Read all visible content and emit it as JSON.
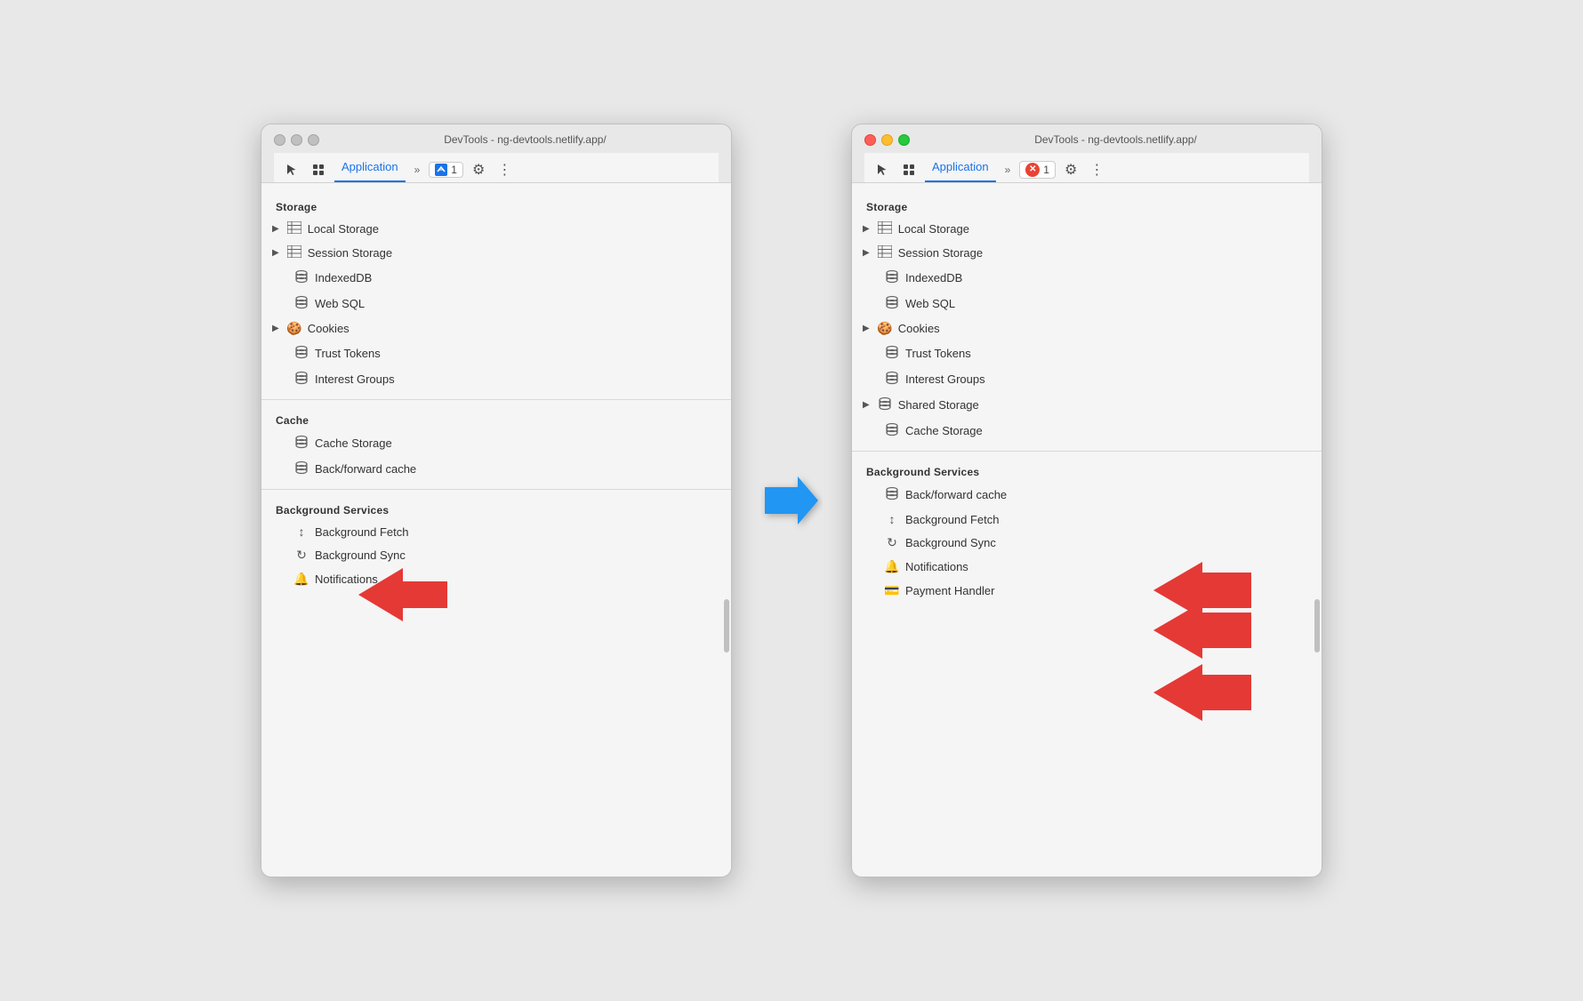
{
  "left_window": {
    "title": "DevTools - ng-devtools.netlify.app/",
    "tab_label": "Application",
    "badge_count": "1",
    "sections": {
      "storage": {
        "label": "Storage",
        "items": [
          {
            "id": "local-storage",
            "icon": "grid",
            "label": "Local Storage",
            "has_arrow": true,
            "indented": false
          },
          {
            "id": "session-storage",
            "icon": "grid",
            "label": "Session Storage",
            "has_arrow": true,
            "indented": false
          },
          {
            "id": "indexeddb",
            "icon": "db",
            "label": "IndexedDB",
            "has_arrow": false,
            "indented": true
          },
          {
            "id": "web-sql",
            "icon": "db",
            "label": "Web SQL",
            "has_arrow": false,
            "indented": true
          },
          {
            "id": "cookies",
            "icon": "cookie",
            "label": "Cookies",
            "has_arrow": true,
            "indented": false
          },
          {
            "id": "trust-tokens",
            "icon": "db",
            "label": "Trust Tokens",
            "has_arrow": false,
            "indented": true
          },
          {
            "id": "interest-groups",
            "icon": "db",
            "label": "Interest Groups",
            "has_arrow": false,
            "indented": true
          }
        ]
      },
      "cache": {
        "label": "Cache",
        "items": [
          {
            "id": "cache-storage",
            "icon": "db",
            "label": "Cache Storage",
            "has_arrow": false,
            "indented": true
          },
          {
            "id": "back-forward",
            "icon": "db",
            "label": "Back/forward cache",
            "has_arrow": false,
            "indented": true
          }
        ]
      },
      "background_services": {
        "label": "Background Services",
        "items": [
          {
            "id": "bg-fetch",
            "icon": "arrows",
            "label": "Background Fetch",
            "has_arrow": false,
            "indented": true
          },
          {
            "id": "bg-sync",
            "icon": "sync",
            "label": "Background Sync",
            "has_arrow": false,
            "indented": true
          },
          {
            "id": "notifications",
            "icon": "bell",
            "label": "Notifications",
            "has_arrow": false,
            "indented": true
          }
        ]
      }
    }
  },
  "right_window": {
    "title": "DevTools - ng-devtools.netlify.app/",
    "tab_label": "Application",
    "badge_count": "1",
    "sections": {
      "storage": {
        "label": "Storage",
        "items": [
          {
            "id": "local-storage",
            "icon": "grid",
            "label": "Local Storage",
            "has_arrow": true,
            "indented": false
          },
          {
            "id": "session-storage",
            "icon": "grid",
            "label": "Session Storage",
            "has_arrow": true,
            "indented": false
          },
          {
            "id": "indexeddb",
            "icon": "db",
            "label": "IndexedDB",
            "has_arrow": false,
            "indented": true
          },
          {
            "id": "web-sql",
            "icon": "db",
            "label": "Web SQL",
            "has_arrow": false,
            "indented": true
          },
          {
            "id": "cookies",
            "icon": "cookie",
            "label": "Cookies",
            "has_arrow": true,
            "indented": false
          },
          {
            "id": "trust-tokens",
            "icon": "db",
            "label": "Trust Tokens",
            "has_arrow": false,
            "indented": true
          },
          {
            "id": "interest-groups",
            "icon": "db",
            "label": "Interest Groups",
            "has_arrow": false,
            "indented": true
          },
          {
            "id": "shared-storage",
            "icon": "db",
            "label": "Shared Storage",
            "has_arrow": true,
            "indented": false
          },
          {
            "id": "cache-storage",
            "icon": "db",
            "label": "Cache Storage",
            "has_arrow": false,
            "indented": true
          }
        ]
      },
      "background_services": {
        "label": "Background Services",
        "items": [
          {
            "id": "back-forward",
            "icon": "db",
            "label": "Back/forward cache",
            "has_arrow": false,
            "indented": true
          },
          {
            "id": "bg-fetch",
            "icon": "arrows",
            "label": "Background Fetch",
            "has_arrow": false,
            "indented": true
          },
          {
            "id": "bg-sync",
            "icon": "sync",
            "label": "Background Sync",
            "has_arrow": false,
            "indented": true
          },
          {
            "id": "notifications",
            "icon": "bell",
            "label": "Notifications",
            "has_arrow": false,
            "indented": true
          },
          {
            "id": "payment-handler",
            "icon": "card",
            "label": "Payment Handler",
            "has_arrow": false,
            "indented": true
          }
        ]
      }
    }
  },
  "icons": {
    "cursor": "⬚",
    "layers": "⧉",
    "chevron_right": "≫",
    "gear": "⚙",
    "dots": "⋮",
    "grid_icon": "⊞",
    "db_icon": "🗄",
    "cookie_icon": "🍪",
    "bell_icon": "🔔",
    "sync_icon": "↻",
    "arrows_icon": "↕",
    "card_icon": "💳",
    "triangle_right": "▶",
    "chat_icon": "💬"
  }
}
